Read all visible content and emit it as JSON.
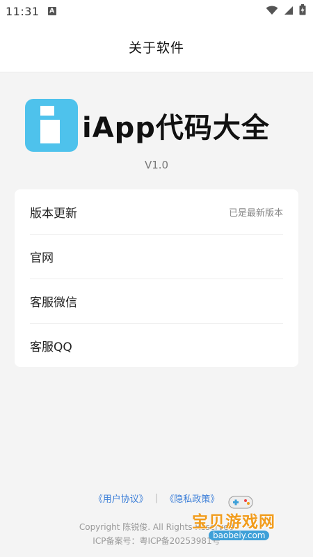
{
  "status_bar": {
    "time": "11:31",
    "notification_glyph": "A"
  },
  "app_bar": {
    "title": "关于软件"
  },
  "app": {
    "name": "iApp代码大全",
    "version": "V1.0",
    "logo_color": "#4ec2ec"
  },
  "menu": {
    "items": [
      {
        "label": "版本更新",
        "value": "已是最新版本"
      },
      {
        "label": "官网",
        "value": ""
      },
      {
        "label": "客服微信",
        "value": ""
      },
      {
        "label": "客服QQ",
        "value": ""
      }
    ]
  },
  "footer": {
    "user_agreement": "《用户协议》",
    "separator": "|",
    "privacy_policy": "《隐私政策》",
    "copyright": "Copyright 陈锐俊. All Rights Reserved",
    "icp": "ICP备案号：粤ICP备20253981号"
  },
  "watermark": {
    "text": "宝贝游戏网",
    "url": "baobeiy.com"
  }
}
